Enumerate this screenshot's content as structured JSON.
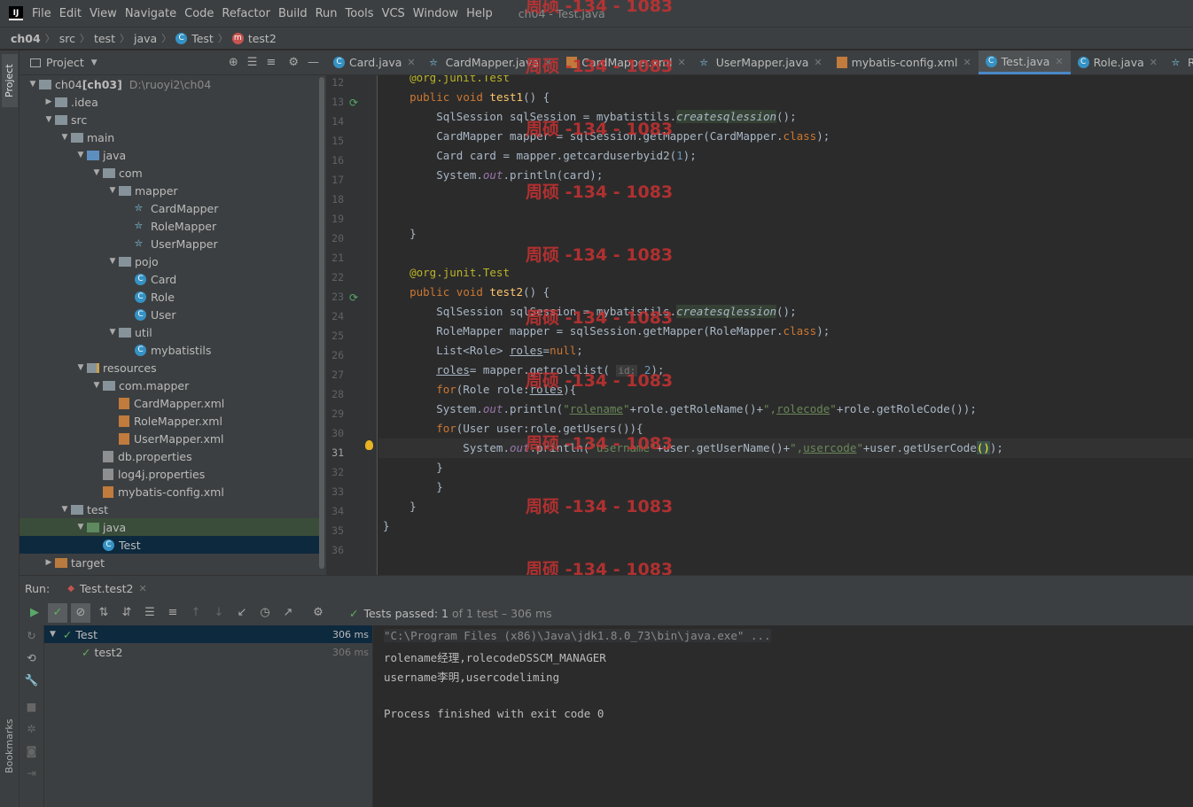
{
  "menubar": {
    "logo": "IJ",
    "items": [
      "File",
      "Edit",
      "View",
      "Navigate",
      "Code",
      "Refactor",
      "Build",
      "Run",
      "Tools",
      "VCS",
      "Window",
      "Help"
    ],
    "title": "ch04 - Test.java"
  },
  "breadcrumb": [
    "ch04",
    "src",
    "test",
    "java",
    "Test",
    "test2"
  ],
  "project": {
    "header": "Project",
    "tree": [
      {
        "label": "ch04",
        "bold_suffix": "[ch03]",
        "path": "D:\\ruoyi2\\ch04",
        "depth": 0,
        "arrow": "v",
        "icon": "folder"
      },
      {
        "label": ".idea",
        "depth": 1,
        "arrow": ">",
        "icon": "folder"
      },
      {
        "label": "src",
        "depth": 1,
        "arrow": "v",
        "icon": "folder"
      },
      {
        "label": "main",
        "depth": 2,
        "arrow": "v",
        "icon": "folder"
      },
      {
        "label": "java",
        "depth": 3,
        "arrow": "v",
        "icon": "folder-blue"
      },
      {
        "label": "com",
        "depth": 4,
        "arrow": "v",
        "icon": "folder"
      },
      {
        "label": "mapper",
        "depth": 5,
        "arrow": "v",
        "icon": "folder"
      },
      {
        "label": "CardMapper",
        "depth": 6,
        "arrow": "",
        "icon": "mapper"
      },
      {
        "label": "RoleMapper",
        "depth": 6,
        "arrow": "",
        "icon": "mapper"
      },
      {
        "label": "UserMapper",
        "depth": 6,
        "arrow": "",
        "icon": "mapper"
      },
      {
        "label": "pojo",
        "depth": 5,
        "arrow": "v",
        "icon": "folder"
      },
      {
        "label": "Card",
        "depth": 6,
        "arrow": "",
        "icon": "class"
      },
      {
        "label": "Role",
        "depth": 6,
        "arrow": "",
        "icon": "class"
      },
      {
        "label": "User",
        "depth": 6,
        "arrow": "",
        "icon": "class"
      },
      {
        "label": "util",
        "depth": 5,
        "arrow": "v",
        "icon": "folder"
      },
      {
        "label": "mybatistils",
        "depth": 6,
        "arrow": "",
        "icon": "class"
      },
      {
        "label": "resources",
        "depth": 3,
        "arrow": "v",
        "icon": "folder-res"
      },
      {
        "label": "com.mapper",
        "depth": 4,
        "arrow": "v",
        "icon": "folder"
      },
      {
        "label": "CardMapper.xml",
        "depth": 5,
        "arrow": "",
        "icon": "xml"
      },
      {
        "label": "RoleMapper.xml",
        "depth": 5,
        "arrow": "",
        "icon": "xml"
      },
      {
        "label": "UserMapper.xml",
        "depth": 5,
        "arrow": "",
        "icon": "xml"
      },
      {
        "label": "db.properties",
        "depth": 4,
        "arrow": "",
        "icon": "props"
      },
      {
        "label": "log4j.properties",
        "depth": 4,
        "arrow": "",
        "icon": "props"
      },
      {
        "label": "mybatis-config.xml",
        "depth": 4,
        "arrow": "",
        "icon": "xml"
      },
      {
        "label": "test",
        "depth": 2,
        "arrow": "v",
        "icon": "folder"
      },
      {
        "label": "java",
        "depth": 3,
        "arrow": "v",
        "icon": "folder-green",
        "state": "hl"
      },
      {
        "label": "Test",
        "depth": 4,
        "arrow": "",
        "icon": "class",
        "state": "sel"
      },
      {
        "label": "target",
        "depth": 1,
        "arrow": ">",
        "icon": "folder-orange"
      }
    ]
  },
  "tabs": [
    {
      "label": "Card.java",
      "icon": "class"
    },
    {
      "label": "CardMapper.java",
      "icon": "mapper"
    },
    {
      "label": "CardMapper.xml",
      "icon": "xml"
    },
    {
      "label": "UserMapper.java",
      "icon": "mapper"
    },
    {
      "label": "mybatis-config.xml",
      "icon": "xml"
    },
    {
      "label": "Test.java",
      "icon": "class",
      "active": true
    },
    {
      "label": "Role.java",
      "icon": "class"
    },
    {
      "label": "Role",
      "icon": "mapper"
    }
  ],
  "code": {
    "line_numbers": [
      "12",
      "13",
      "14",
      "15",
      "16",
      "17",
      "18",
      "19",
      "20",
      "21",
      "22",
      "23",
      "24",
      "25",
      "26",
      "27",
      "28",
      "29",
      "30",
      "31",
      "32",
      "33",
      "34",
      "35",
      "36"
    ],
    "current_line": "31"
  },
  "watermark": "周硕 -134 - 1083",
  "run": {
    "label": "Run:",
    "tab": "Test.test2",
    "status_prefix": "Tests passed:",
    "status_count": "1",
    "status_suffix": "of 1 test – 306 ms",
    "tests": [
      {
        "name": "Test",
        "time": "306 ms"
      },
      {
        "name": "test2",
        "time": "306 ms"
      }
    ],
    "console": [
      "\"C:\\Program Files (x86)\\Java\\jdk1.8.0_73\\bin\\java.exe\" ...",
      "rolename经理,rolecodeDSSCM_MANAGER",
      "username李明,usercodeliming",
      "",
      "Process finished with exit code 0"
    ]
  },
  "side": {
    "project_tab": "Project",
    "bookmarks_tab": "Bookmarks"
  }
}
